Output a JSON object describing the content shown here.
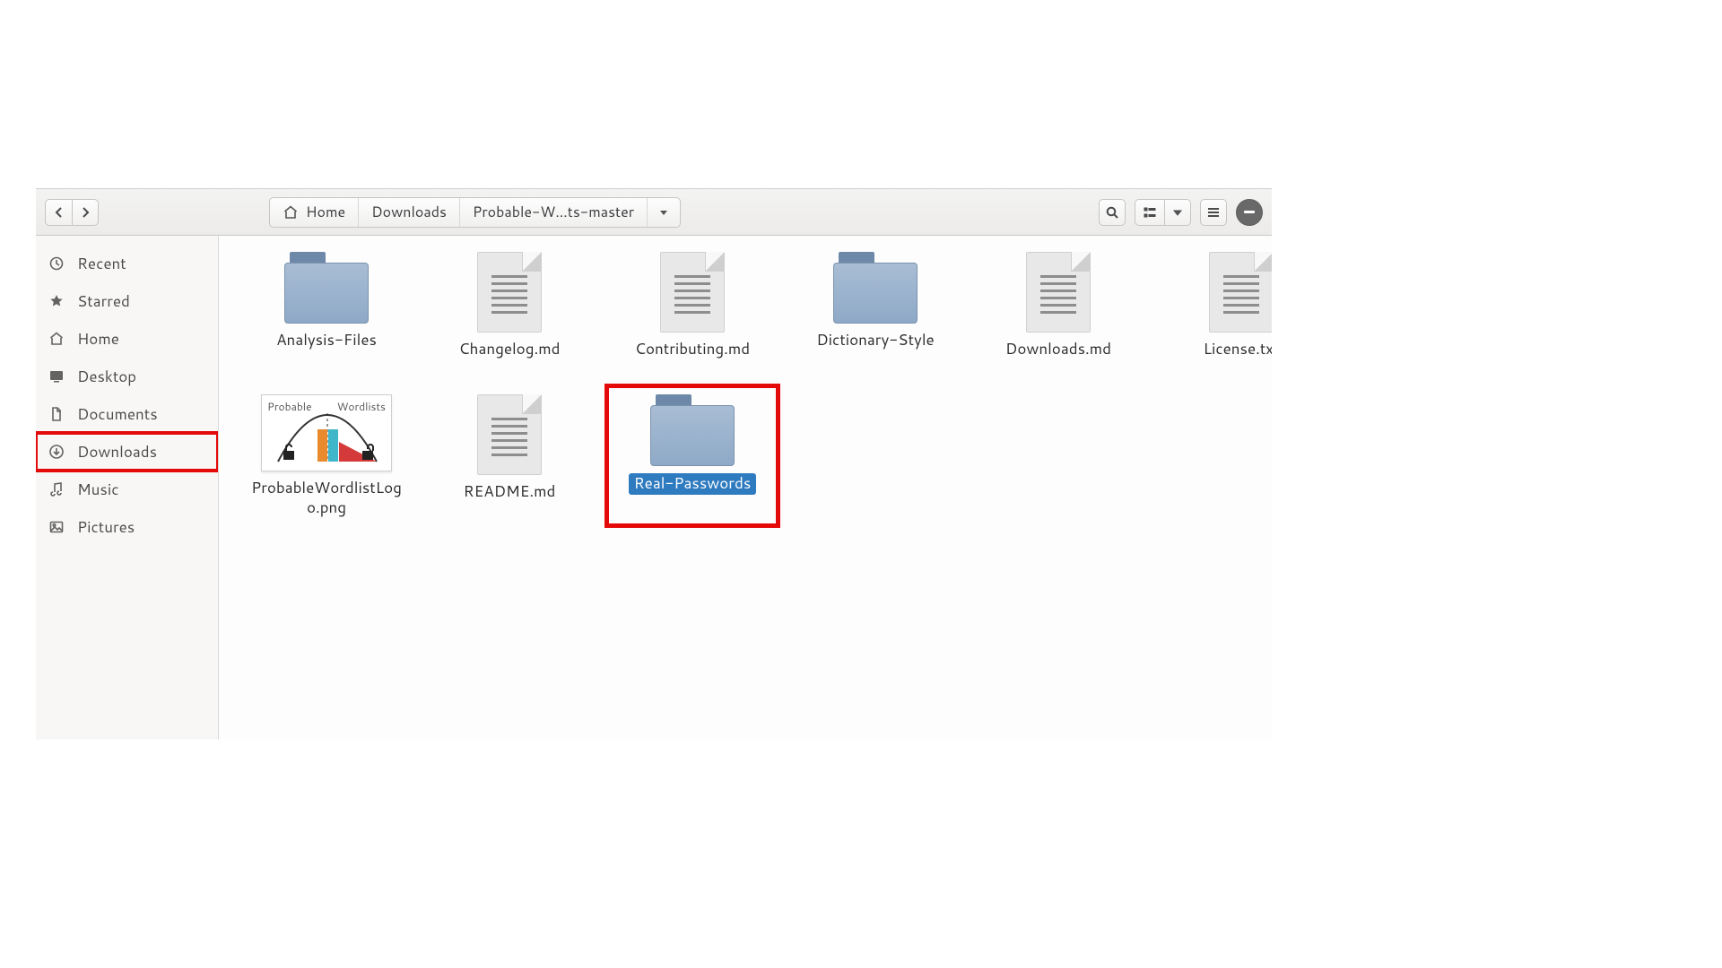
{
  "toolbar": {
    "path": [
      "Home",
      "Downloads",
      "Probable-W…ts-master"
    ]
  },
  "sidebar": {
    "items": [
      {
        "id": "recent",
        "label": "Recent",
        "icon": "clock"
      },
      {
        "id": "starred",
        "label": "Starred",
        "icon": "star"
      },
      {
        "id": "home",
        "label": "Home",
        "icon": "home"
      },
      {
        "id": "desktop",
        "label": "Desktop",
        "icon": "desktop"
      },
      {
        "id": "documents",
        "label": "Documents",
        "icon": "document"
      },
      {
        "id": "downloads",
        "label": "Downloads",
        "icon": "download",
        "highlighted": true
      },
      {
        "id": "music",
        "label": "Music",
        "icon": "music"
      },
      {
        "id": "pictures",
        "label": "Pictures",
        "icon": "pictures"
      }
    ]
  },
  "files": [
    {
      "name": "Analysis-Files",
      "type": "folder"
    },
    {
      "name": "Changelog.md",
      "type": "text"
    },
    {
      "name": "Contributing.md",
      "type": "text"
    },
    {
      "name": "Dictionary-Style",
      "type": "folder"
    },
    {
      "name": "Downloads.md",
      "type": "text"
    },
    {
      "name": "License.txt",
      "type": "text"
    },
    {
      "name": "ProbableWordlistLogo.png",
      "type": "image",
      "thumb": {
        "left_text": "Probable",
        "right_text": "Wordlists"
      }
    },
    {
      "name": "README.md",
      "type": "text"
    },
    {
      "name": "Real-Passwords",
      "type": "folder",
      "selected": true,
      "annotated": true
    }
  ],
  "colors": {
    "accent": "#2f7bbf",
    "annotation": "#e40a0a"
  }
}
